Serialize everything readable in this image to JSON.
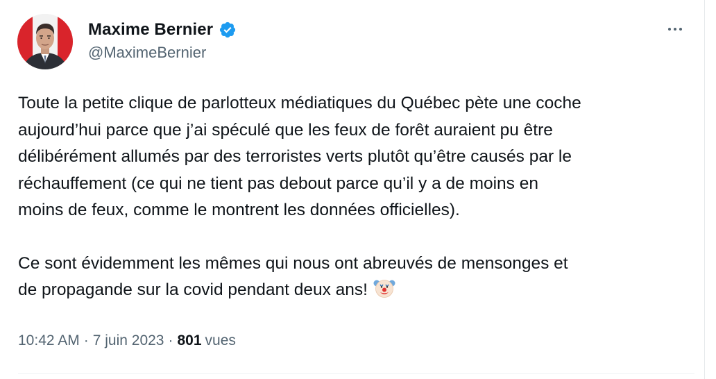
{
  "author": {
    "display_name": "Maxime Bernier",
    "handle": "@MaximeBernier",
    "verified": true,
    "avatar_icon": "profile-photo"
  },
  "tweet": {
    "paragraphs": [
      [
        "Toute la petite clique de parlotteux médiatiques du Québec pète une coche",
        "aujourd’hui parce que j’ai spéculé que les feux de forêt auraient pu être",
        "délibérément allumés par des terroristes verts plutôt qu’être causés par le",
        "réchauffement (ce qui ne tient pas debout parce qu’il y a de moins en",
        "moins de feux, comme le montrent les données officielles)."
      ],
      [
        "Ce sont évidemment les mêmes qui nous ont abreuvés de mensonges et",
        "de propagande sur la covid pendant deux ans!"
      ]
    ],
    "emoji": "clown-face"
  },
  "meta": {
    "time": "10:42 AM",
    "separator": "·",
    "date": "7 juin 2023",
    "views_count": "801",
    "views_label": "vues"
  },
  "colors": {
    "text_primary": "#0f1419",
    "text_secondary": "#536471",
    "verified_blue": "#1d9bf0"
  }
}
